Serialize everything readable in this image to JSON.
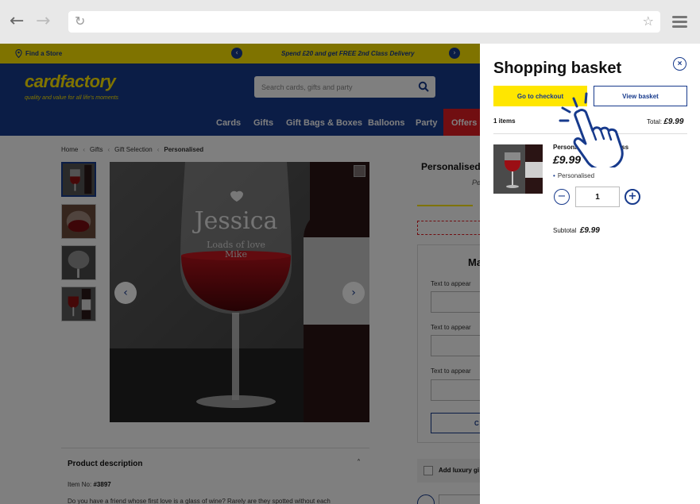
{
  "browser": {
    "back_icon": "arrow-left-icon",
    "forward_icon": "arrow-right-icon",
    "reload_icon": "reload-icon",
    "bookmark_icon": "star-icon",
    "menu_icon": "hamburger-menu-icon",
    "url": ""
  },
  "promo": {
    "store_link": "Find a Store",
    "message": "Spend £20 and get FREE 2nd Class Delivery"
  },
  "header": {
    "logo": "cardfactory",
    "tagline": "quality and value for all life's moments",
    "search_placeholder": "Search cards, gifts and party"
  },
  "nav": {
    "items": [
      "Cards",
      "Gifts",
      "Gift Bags & Boxes",
      "Balloons",
      "Party",
      "Offers"
    ]
  },
  "breadcrumb": [
    "Home",
    "Gifts",
    "Gift Selection",
    "Personalised"
  ],
  "product": {
    "title": "Personalised",
    "subtitle": "Pe",
    "image_engraving_name": "Jessica",
    "image_engraving_line1": "Loads of love",
    "image_engraving_line2": "Mike",
    "form_heading": "Ma",
    "form_labels": [
      "Text to appear",
      "Text to appear",
      "Text to appear"
    ],
    "form_button": "C",
    "luxury_label": "Add luxury gi",
    "description_title": "Product description",
    "item_no_label": "Item No:",
    "item_no": "#3897",
    "description_text": "Do you have a friend whose first love is a glass of wine? Rarely are they spotted without each"
  },
  "basket": {
    "title": "Shopping basket",
    "close_label": "×",
    "checkout_label": "Go to checkout",
    "view_basket_label": "View basket",
    "items_count": "1 items",
    "total_label": "Total:",
    "total_value": "£9.99",
    "item": {
      "name": "Personalised Wine Glass",
      "price": "£9.99",
      "option": "Personalised",
      "quantity": "1"
    },
    "subtotal_label": "Subtotal",
    "subtotal_value": "£9.99"
  },
  "colors": {
    "brand_blue": "#173a8c",
    "brand_yellow": "#ffe600",
    "offers_red": "#e31c23"
  }
}
